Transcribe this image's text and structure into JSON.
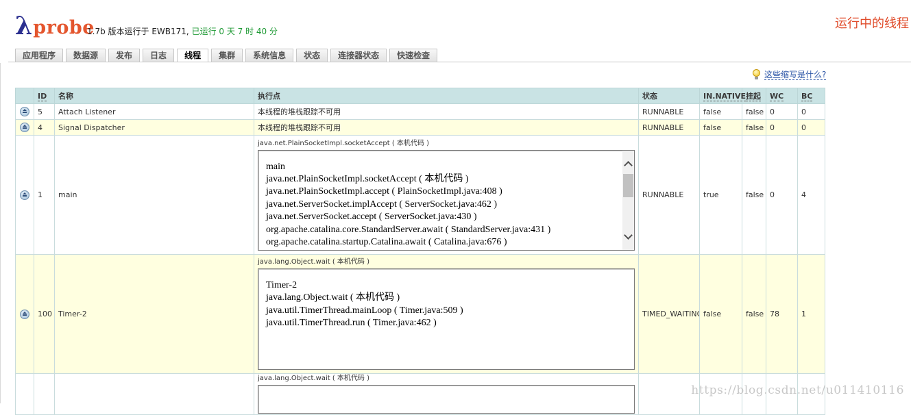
{
  "header": {
    "logo_lambda": "λ",
    "logo_text": "probe",
    "version_prefix": "1.7b 版本运行于 EWB171,",
    "uptime": "已运行 0 天 7 时 40 分",
    "page_title": "运行中的线程"
  },
  "tabs": [
    {
      "label": "应用程序",
      "active": false
    },
    {
      "label": "数据源",
      "active": false
    },
    {
      "label": "发布",
      "active": false
    },
    {
      "label": "日志",
      "active": false
    },
    {
      "label": "线程",
      "active": true
    },
    {
      "label": "集群",
      "active": false
    },
    {
      "label": "系统信息",
      "active": false
    },
    {
      "label": "状态",
      "active": false
    },
    {
      "label": "连接器状态",
      "active": false
    },
    {
      "label": "快速检查",
      "active": false
    }
  ],
  "help": {
    "label": "这些缩写是什么?"
  },
  "table": {
    "headers": {
      "id": "ID",
      "name": "名称",
      "exec": "执行点",
      "state": "状态",
      "native": "IN.NATIVE",
      "suspended": "挂起",
      "wc": "WC",
      "bc": "BC"
    },
    "rows": [
      {
        "id": "5",
        "name": "Attach Listener",
        "exec_label": "本线程的堆栈跟踪不可用",
        "state": "RUNNABLE",
        "native": "false",
        "suspended": "false",
        "wc": "0",
        "bc": "0"
      },
      {
        "id": "4",
        "name": "Signal Dispatcher",
        "exec_label": "本线程的堆栈跟踪不可用",
        "state": "RUNNABLE",
        "native": "false",
        "suspended": "false",
        "wc": "0",
        "bc": "0"
      },
      {
        "id": "1",
        "name": "main",
        "exec_label": "java.net.PlainSocketImpl.socketAccept ( 本机代码 )",
        "state": "RUNNABLE",
        "native": "true",
        "suspended": "false",
        "wc": "0",
        "bc": "4",
        "trace": [
          "main",
          "java.net.PlainSocketImpl.socketAccept ( 本机代码 )",
          "java.net.PlainSocketImpl.accept ( PlainSocketImpl.java:408 )",
          "java.net.ServerSocket.implAccept ( ServerSocket.java:462 )",
          "java.net.ServerSocket.accept ( ServerSocket.java:430 )",
          "org.apache.catalina.core.StandardServer.await ( StandardServer.java:431 )",
          "org.apache.catalina.startup.Catalina.await ( Catalina.java:676 )"
        ]
      },
      {
        "id": "100",
        "name": "Timer-2",
        "exec_label": "java.lang.Object.wait ( 本机代码 )",
        "state": "TIMED_WAITING",
        "native": "false",
        "suspended": "false",
        "wc": "78",
        "bc": "1",
        "trace": [
          "Timer-2",
          "java.lang.Object.wait ( 本机代码 )",
          "java.util.TimerThread.mainLoop ( Timer.java:509 )",
          "java.util.TimerThread.run ( Timer.java:462 )"
        ]
      },
      {
        "exec_label": "java.lang.Object.wait ( 本机代码 )"
      }
    ]
  },
  "watermark": "https://blog.csdn.net/u011410116"
}
